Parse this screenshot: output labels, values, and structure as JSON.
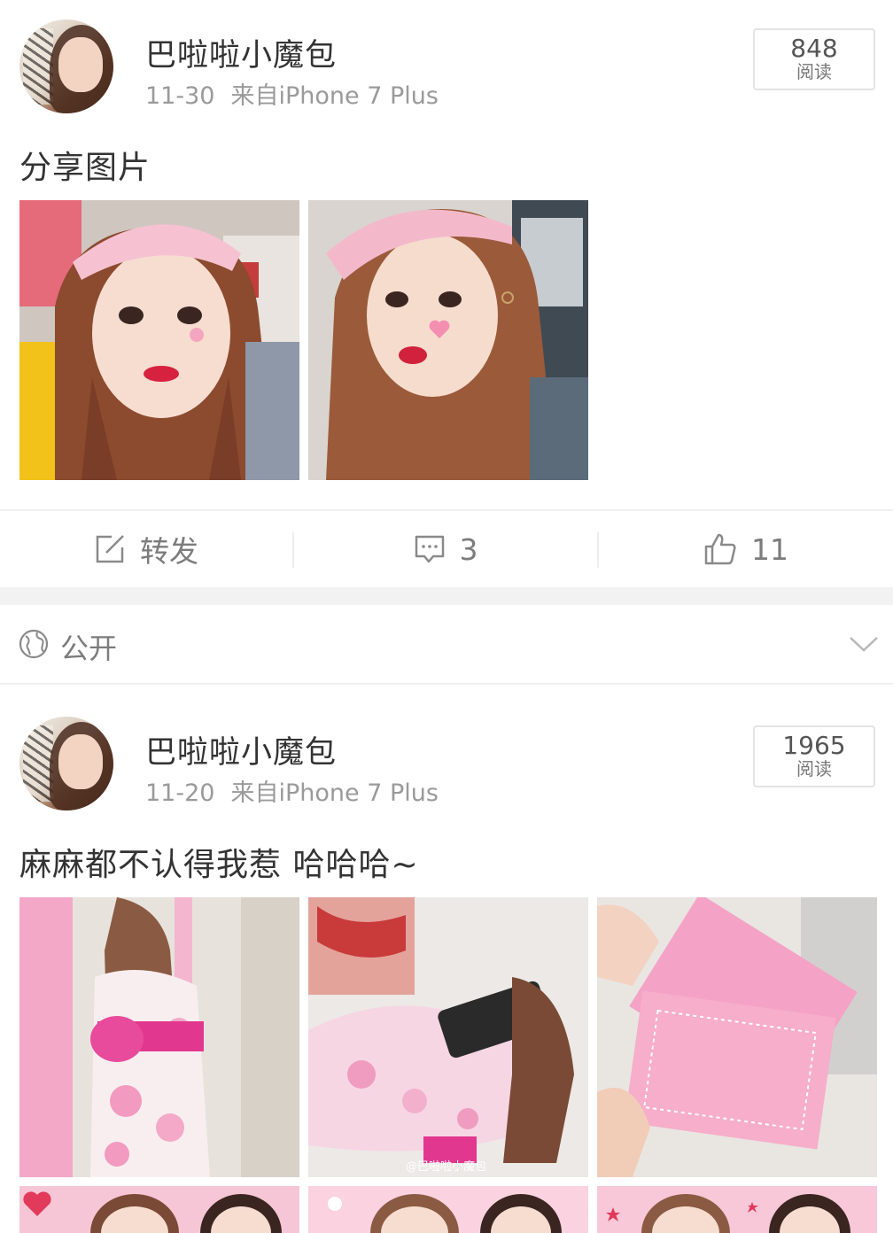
{
  "posts": [
    {
      "username": "巴啦啦小魔包",
      "date": "11-30",
      "source": "来自iPhone 7 Plus",
      "reads": "848",
      "reads_label": "阅读",
      "text": "分享图片"
    },
    {
      "username": "巴啦啦小魔包",
      "date": "11-20",
      "source": "来自iPhone 7 Plus",
      "reads": "1965",
      "reads_label": "阅读",
      "text": "麻麻都不认得我惹 哈哈哈~",
      "image_watermarks": [
        "@巴啦啦小魔包"
      ]
    }
  ],
  "actions": {
    "repost_label": "转发",
    "comment_count": "3",
    "like_count": "11"
  },
  "visibility": {
    "label": "公开"
  },
  "colors": {
    "text_primary": "#333333",
    "text_secondary": "#9a9a9a",
    "action_gray": "#7c7c7c",
    "divider": "#f2f2f2",
    "accent_pink": "#f2a3c4"
  }
}
